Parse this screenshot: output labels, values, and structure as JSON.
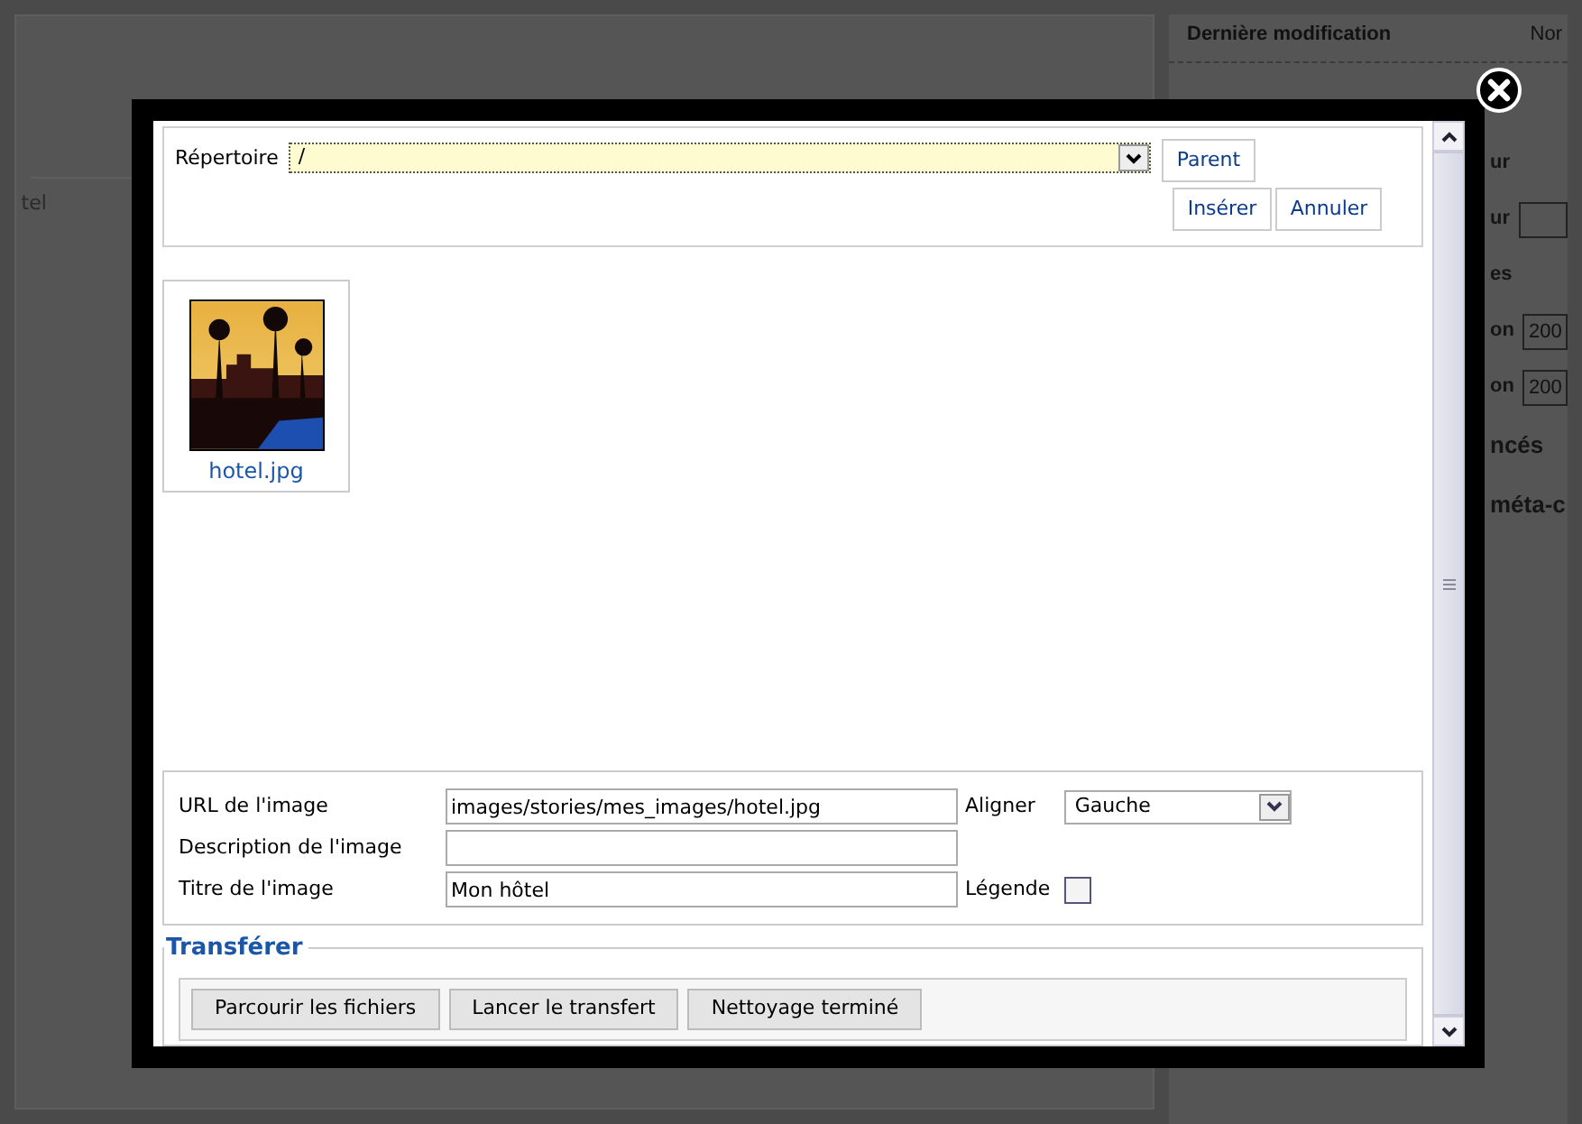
{
  "background": {
    "left_texts": [
      "tel"
    ],
    "header": {
      "label": "Dernière modification",
      "value": "Nor"
    },
    "fragments": [
      {
        "kind": "text",
        "label": "ur"
      },
      {
        "kind": "field",
        "label": "ur"
      },
      {
        "kind": "text",
        "label": "es"
      },
      {
        "kind": "field",
        "label": "on",
        "value": "200"
      },
      {
        "kind": "field",
        "label": "on",
        "value": "200"
      },
      {
        "kind": "heading",
        "label": "ncés"
      },
      {
        "kind": "heading",
        "label": "méta-c"
      }
    ]
  },
  "dialog": {
    "directory": {
      "label": "Répertoire",
      "value": "/"
    },
    "buttons": {
      "parent": "Parent",
      "insert": "Insérer",
      "cancel": "Annuler"
    },
    "images": [
      {
        "name": "hotel.jpg",
        "kind": "picture"
      }
    ],
    "form": {
      "url": {
        "label": "URL de l'image",
        "value": "images/stories/mes_images/hotel.jpg"
      },
      "align": {
        "label": "Aligner",
        "value": "Gauche"
      },
      "description": {
        "label": "Description de l'image"
      },
      "title": {
        "label": "Titre de l'image",
        "value": "Mon hôtel"
      },
      "caption": {
        "label": "Légende",
        "checked": false
      }
    },
    "upload": {
      "legend": "Transférer",
      "buttons": [
        "Parcourir les fichiers",
        "Lancer le transfert",
        "Nettoyage terminé"
      ]
    }
  }
}
